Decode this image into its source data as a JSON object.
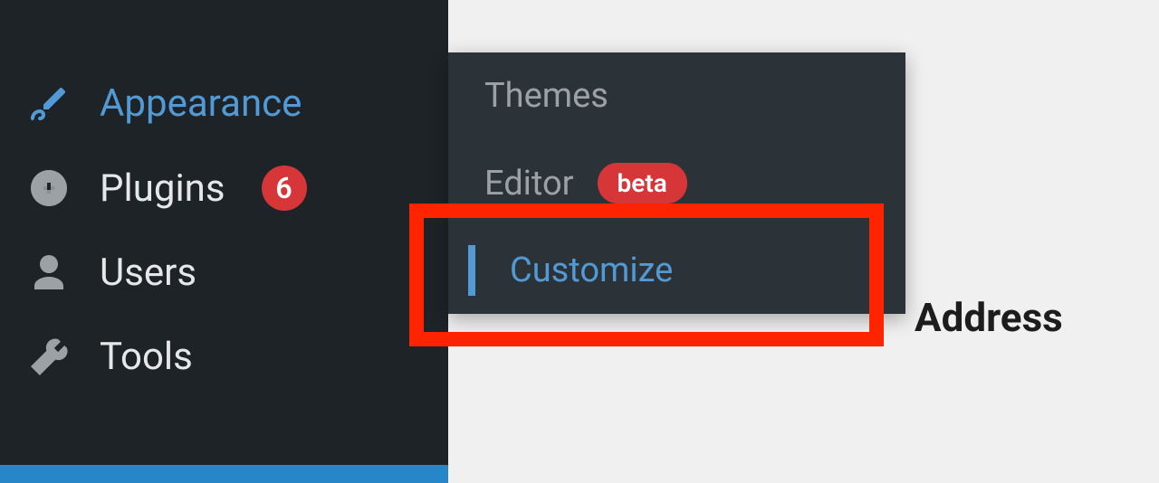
{
  "sidebar": {
    "items": [
      {
        "label": "Appearance",
        "active": true
      },
      {
        "label": "Plugins",
        "badge": "6"
      },
      {
        "label": "Users"
      },
      {
        "label": "Tools"
      }
    ]
  },
  "submenu": {
    "items": [
      {
        "label": "Themes"
      },
      {
        "label": "Editor",
        "beta": "beta"
      },
      {
        "label": "Customize",
        "active": true
      }
    ]
  },
  "content": {
    "label": "Address"
  }
}
